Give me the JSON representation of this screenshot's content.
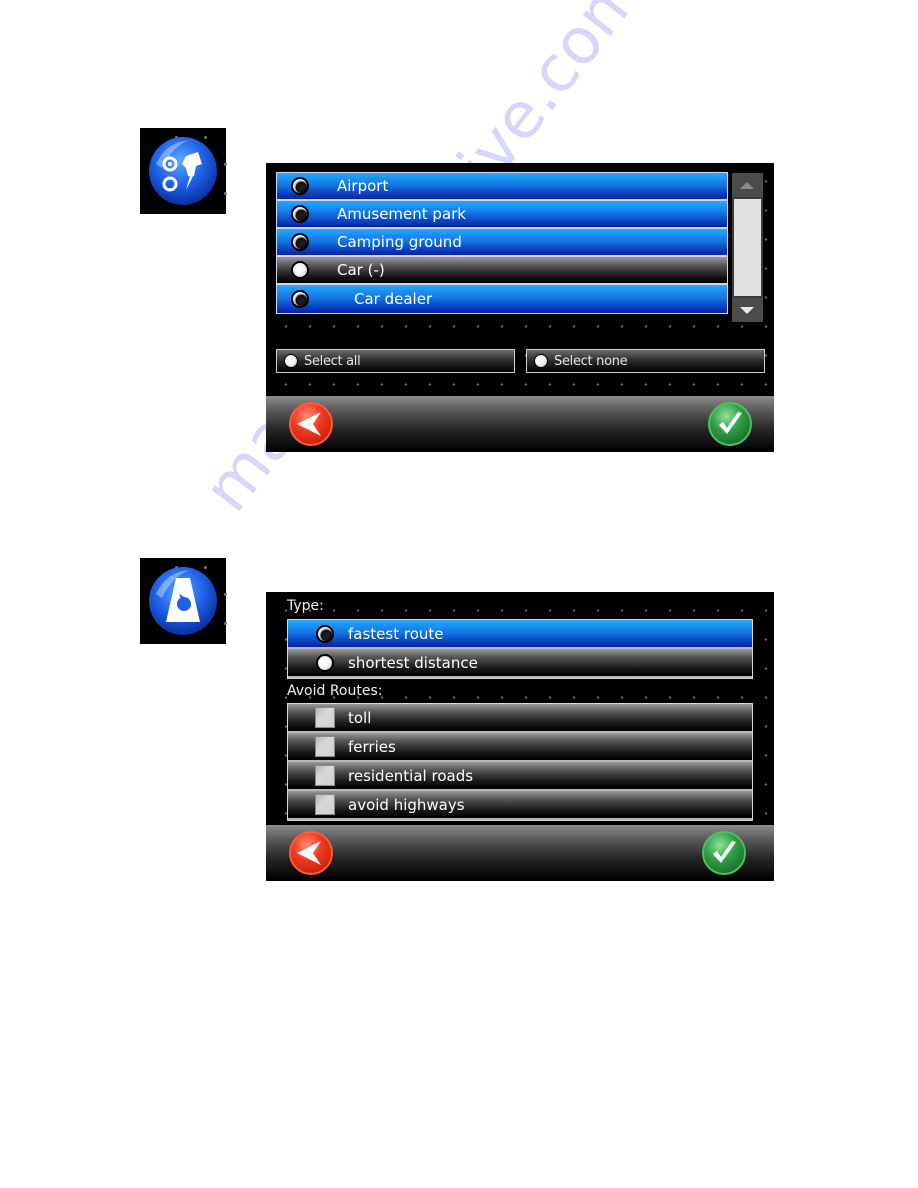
{
  "figure1": {
    "icon": "poi-category-icon",
    "list_items": [
      {
        "label": "Airport",
        "state": "selected",
        "indent": false
      },
      {
        "label": "Amusement park",
        "state": "selected",
        "indent": false
      },
      {
        "label": "Camping ground",
        "state": "selected",
        "indent": false
      },
      {
        "label": "Car (-)",
        "state": "unselected",
        "indent": false
      },
      {
        "label": "Car dealer",
        "state": "selected",
        "indent": true
      }
    ],
    "scrollbar": {
      "up_icon": "arrow-up-icon",
      "down_icon": "arrow-down-icon"
    },
    "select_all_label": "Select all",
    "select_none_label": "Select none",
    "back_icon": "back-arrow-icon",
    "confirm_icon": "checkmark-icon"
  },
  "figure2": {
    "icon": "route-settings-icon",
    "type_label": "Type:",
    "type_options": [
      {
        "label": "fastest route",
        "selected": true
      },
      {
        "label": "shortest distance",
        "selected": false
      }
    ],
    "avoid_label": "Avoid Routes:",
    "avoid_options": [
      {
        "label": "toll",
        "checked": false
      },
      {
        "label": "ferries",
        "checked": false
      },
      {
        "label": "residential roads",
        "checked": false
      },
      {
        "label": "avoid highways",
        "checked": false
      }
    ],
    "back_icon": "back-arrow-icon",
    "confirm_icon": "checkmark-icon"
  },
  "watermark": "manualsarchive.com",
  "colors": {
    "selected_row": "#1478e6",
    "unselected_row": "#2a2a2a",
    "back_button": "#f03a20",
    "confirm_button": "#2fa046"
  }
}
